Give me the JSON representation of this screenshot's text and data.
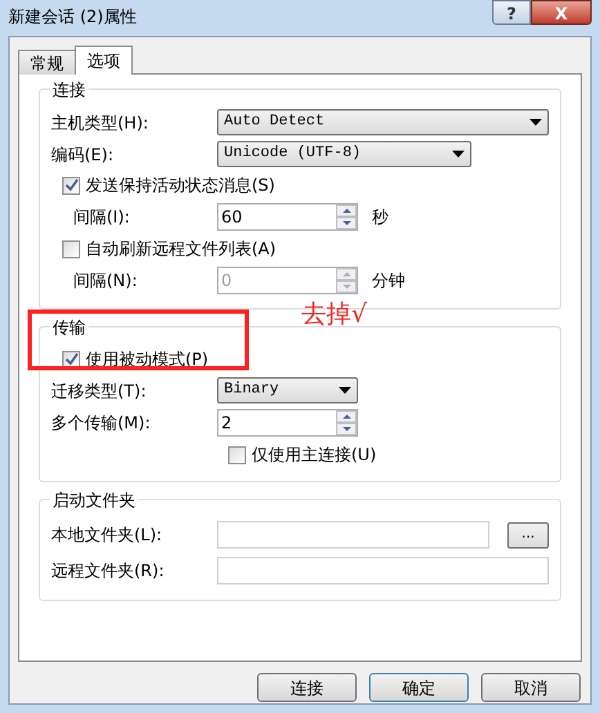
{
  "window": {
    "title": "新建会话 (2)属性",
    "help": "?",
    "close": "X"
  },
  "tabs": [
    {
      "label": "常规",
      "selected": false
    },
    {
      "label": "选项",
      "selected": true
    }
  ],
  "groups": [
    {
      "legend": "连接",
      "rows": [
        {
          "kind": "combo",
          "label": "主机类型(H):",
          "value": "Auto Detect"
        },
        {
          "kind": "combo",
          "label": "编码(E):",
          "value": "Unicode (UTF-8)"
        },
        {
          "kind": "checkbox",
          "label": "发送保持活动状态消息(S)",
          "checked": true
        },
        {
          "kind": "spin",
          "label": "间隔(I):",
          "value": "60",
          "unit": "秒",
          "disabled": false
        },
        {
          "kind": "checkbox",
          "label": "自动刷新远程文件列表(A)",
          "checked": false
        },
        {
          "kind": "spin",
          "label": "间隔(N):",
          "value": "0",
          "unit": "分钟",
          "disabled": true
        }
      ]
    },
    {
      "legend": "传输",
      "annotation": {
        "text": "去掉√"
      },
      "rows": [
        {
          "kind": "checkbox",
          "label": "使用被动模式(P)",
          "checked": true
        },
        {
          "kind": "combo",
          "label": "迁移类型(T):",
          "value": "Binary"
        },
        {
          "kind": "spin",
          "label": "多个传输(M):",
          "value": "2",
          "disabled": false
        },
        {
          "kind": "option",
          "label": "仅使用主连接(U)",
          "checked": false
        }
      ]
    },
    {
      "legend": "启动文件夹",
      "rows": [
        {
          "kind": "browse",
          "label": "本地文件夹(L):",
          "button": "..."
        },
        {
          "kind": "text",
          "label": "远程文件夹(R):"
        }
      ]
    }
  ],
  "buttons": [
    {
      "label": "连接",
      "default": false
    },
    {
      "label": "确定",
      "default": true
    },
    {
      "label": "取消",
      "default": false
    }
  ]
}
